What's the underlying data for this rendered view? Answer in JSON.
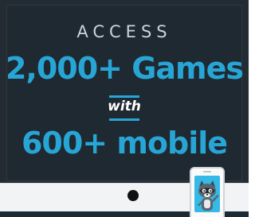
{
  "headline": {
    "access": "ACCESS",
    "games": "2,000+ Games",
    "with": "with",
    "mobile": "600+ mobile"
  },
  "colors": {
    "bezel": "#232b33",
    "screen": "#1f2931",
    "accent_blue": "#27a6d6",
    "access_text": "#c9d3d9",
    "chin": "#f2f3f4",
    "phone_screen": "#35b9e6"
  },
  "icons": {
    "mascot": "cartoon-raccoon-mascot-icon",
    "home_button": "monitor-home-button-icon",
    "phone": "mobile-phone-icon"
  }
}
